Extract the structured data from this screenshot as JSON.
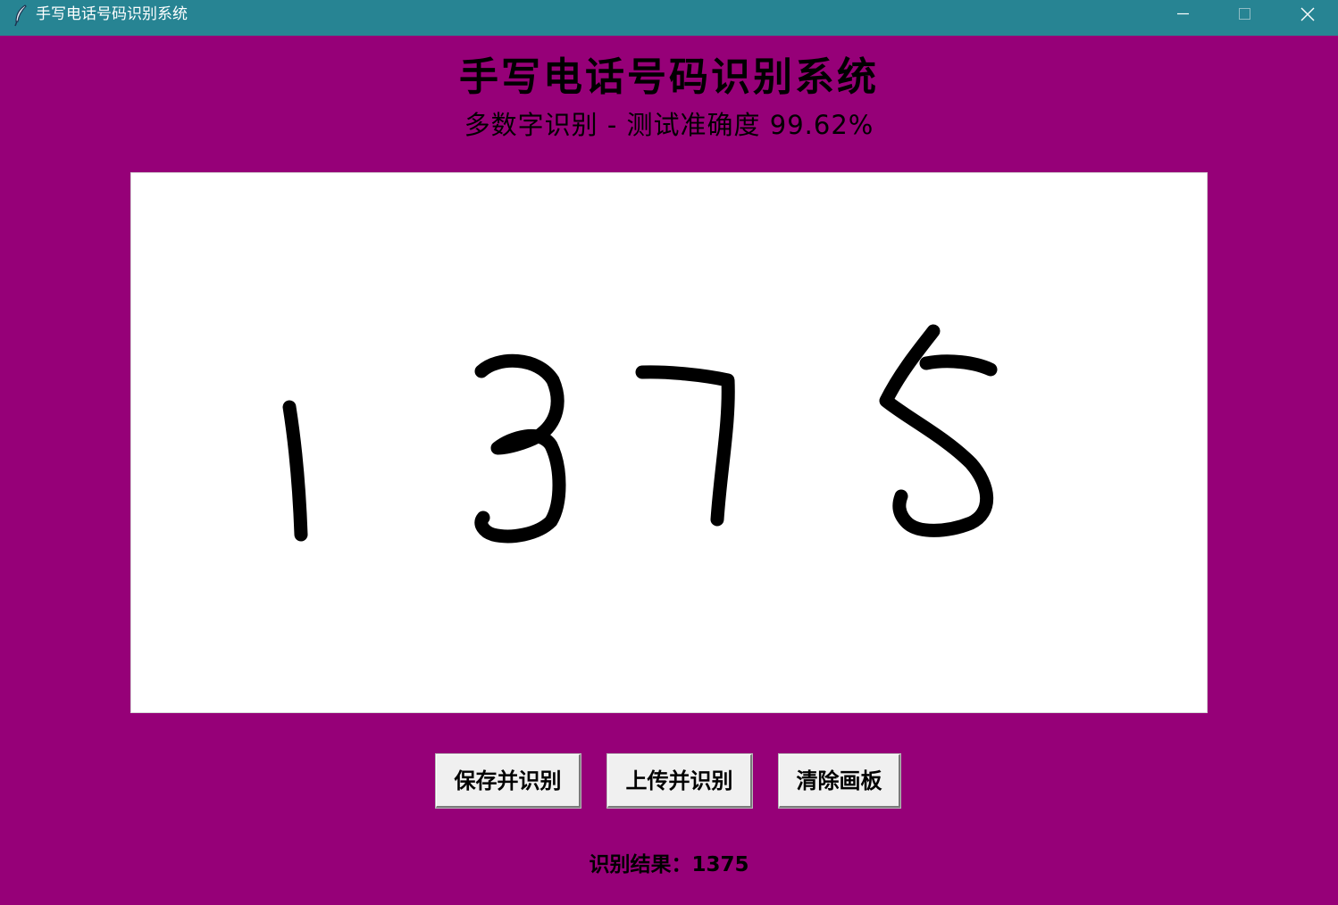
{
  "window": {
    "title": "手写电话号码识别系统",
    "icon": "feather-icon",
    "controls": [
      "minimize-icon",
      "maximize-icon",
      "close-icon"
    ]
  },
  "header": {
    "title": "手写电话号码识别系统",
    "subtitle": "多数字识别 - 测试准确度 99.62%"
  },
  "canvas": {
    "drawn_digits": "1375"
  },
  "buttons": {
    "save_label": "保存并识别",
    "upload_label": "上传并识别",
    "clear_label": "清除画板"
  },
  "result": {
    "label": "识别结果：",
    "value": "1375",
    "text": "识别结果：1375"
  },
  "colors": {
    "background": "#960078",
    "titlebar": "#278493",
    "canvas": "#ffffff",
    "ink": "#000000",
    "button": "#f0f0f0"
  }
}
